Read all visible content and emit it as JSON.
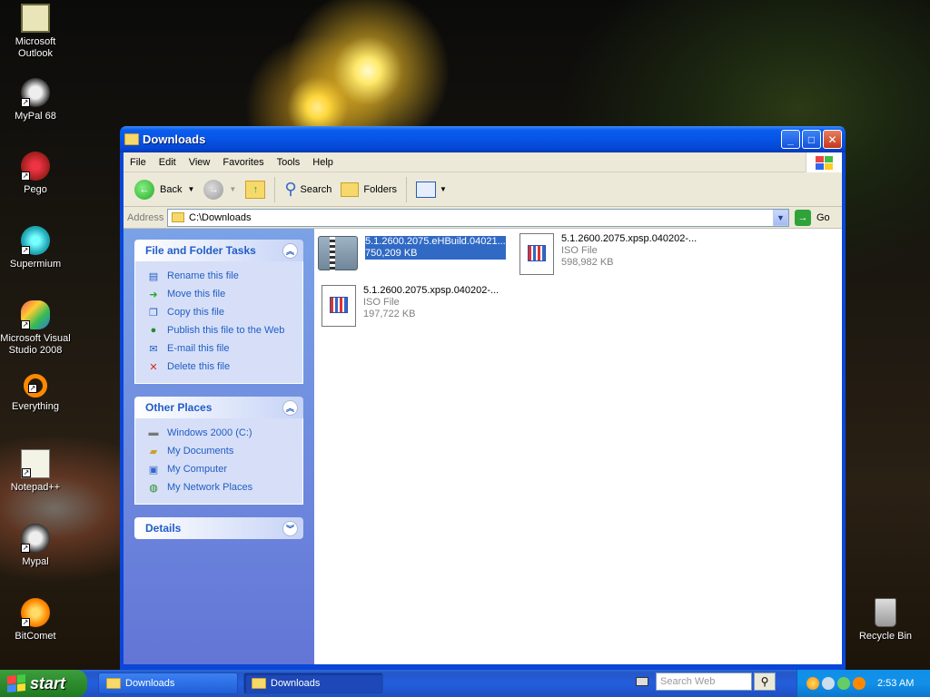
{
  "desktop": {
    "icons": [
      {
        "label": "Microsoft Outlook"
      },
      {
        "label": "MyPal 68"
      },
      {
        "label": "Pego"
      },
      {
        "label": "Supermium"
      },
      {
        "label": "Microsoft Visual Studio 2008"
      },
      {
        "label": "Everything"
      },
      {
        "label": "Notepad++"
      },
      {
        "label": "Mypal"
      },
      {
        "label": "BitComet"
      },
      {
        "label": "Recycle Bin"
      }
    ]
  },
  "window": {
    "title": "Downloads",
    "menu": [
      "File",
      "Edit",
      "View",
      "Favorites",
      "Tools",
      "Help"
    ],
    "toolbar": {
      "back": "Back",
      "search": "Search",
      "folders": "Folders"
    },
    "address": {
      "label": "Address",
      "value": "C:\\Downloads",
      "go": "Go"
    },
    "tasks": {
      "file_folder": {
        "title": "File and Folder Tasks",
        "items": [
          "Rename this file",
          "Move this file",
          "Copy this file",
          "Publish this file to the Web",
          "E-mail this file",
          "Delete this file"
        ]
      },
      "other_places": {
        "title": "Other Places",
        "items": [
          "Windows 2000 (C:)",
          "My Documents",
          "My Computer",
          "My Network Places"
        ]
      },
      "details": {
        "title": "Details"
      }
    },
    "files": [
      {
        "name": "5.1.2600.2075.eHBuild.04021...",
        "type": "",
        "size": "750,209 KB",
        "icon": "zip-folder-icon",
        "selected": true
      },
      {
        "name": "5.1.2600.2075.xpsp.040202-...",
        "type": "ISO File",
        "size": "598,982 KB",
        "icon": "iso-file-icon",
        "selected": false
      },
      {
        "name": "5.1.2600.2075.xpsp.040202-...",
        "type": "ISO File",
        "size": "197,722 KB",
        "icon": "iso-file-icon",
        "selected": false
      }
    ]
  },
  "taskbar": {
    "start": "start",
    "buttons": [
      "Downloads",
      "Downloads"
    ],
    "search_placeholder": "Search Web",
    "clock": "2:53 AM"
  }
}
